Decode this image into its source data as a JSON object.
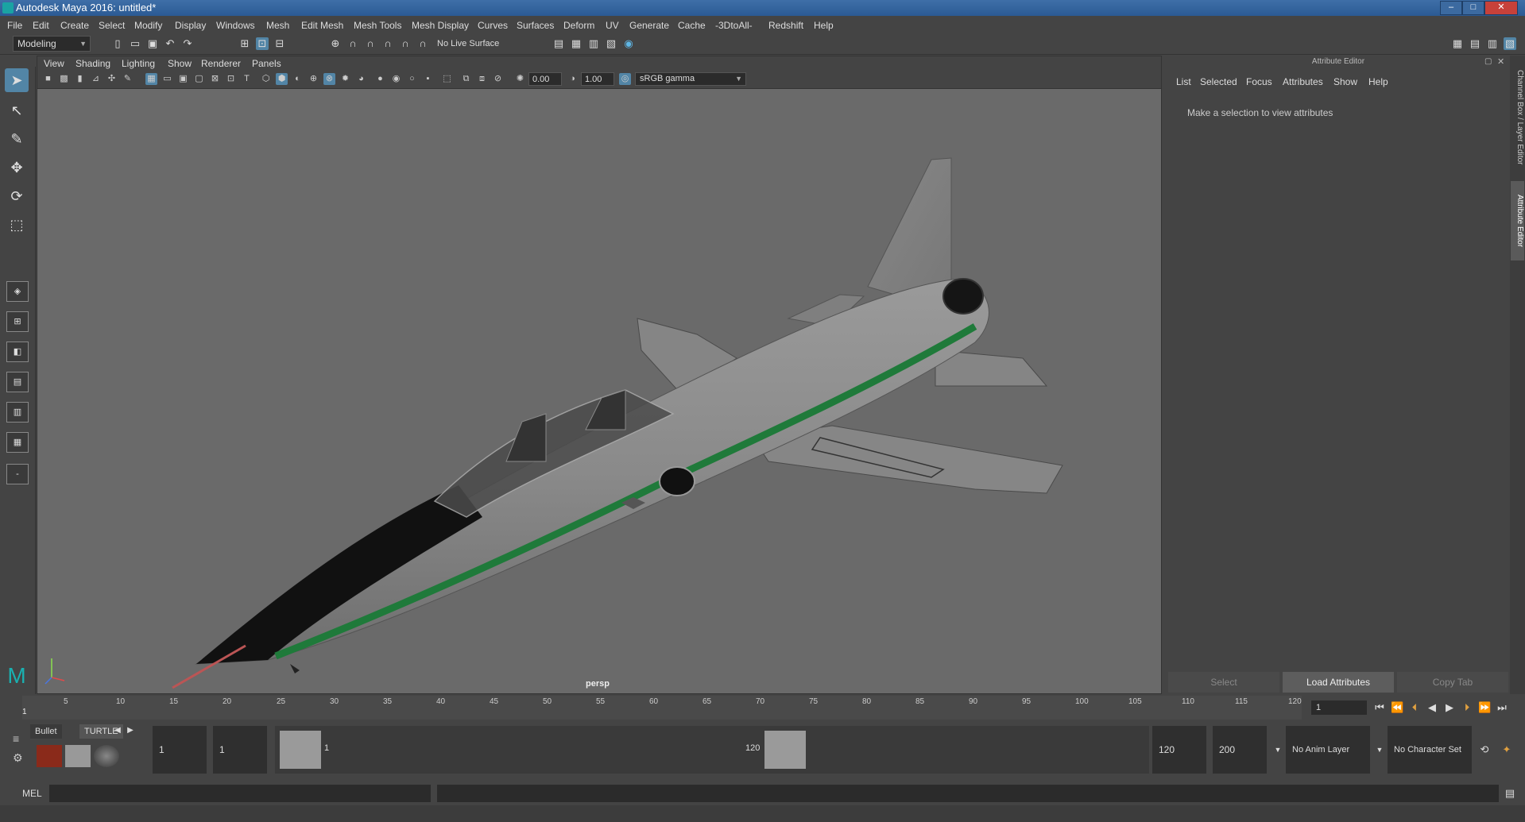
{
  "window": {
    "title": "Autodesk Maya 2016: untitled*"
  },
  "menubar": [
    "File",
    "Edit",
    "Create",
    "Select",
    "Modify",
    "Display",
    "Windows",
    "Mesh",
    "Edit Mesh",
    "Mesh Tools",
    "Mesh Display",
    "Curves",
    "Surfaces",
    "Deform",
    "UV",
    "Generate",
    "Cache",
    "-3DtoAll-",
    "Redshift",
    "Help"
  ],
  "status": {
    "menuset": "Modeling",
    "live_surface": "No Live Surface"
  },
  "viewport": {
    "menu": [
      "View",
      "Shading",
      "Lighting",
      "Show",
      "Renderer",
      "Panels"
    ],
    "exposure": "0.00",
    "gamma": "1.00",
    "color_space": "sRGB gamma",
    "camera": "persp"
  },
  "attribute_editor": {
    "title": "Attribute Editor",
    "menu": [
      "List",
      "Selected",
      "Focus",
      "Attributes",
      "Show",
      "Help"
    ],
    "message": "Make a selection to view attributes",
    "buttons": {
      "select": "Select",
      "load": "Load Attributes",
      "copy": "Copy Tab"
    }
  },
  "side_tabs": {
    "channel_box": "Channel Box / Layer Editor",
    "attr_editor": "Attribute Editor"
  },
  "timeline": {
    "ticks": [
      "5",
      "10",
      "15",
      "20",
      "25",
      "30",
      "35",
      "40",
      "45",
      "50",
      "55",
      "60",
      "65",
      "70",
      "75",
      "80",
      "85",
      "90",
      "95",
      "100",
      "105",
      "110",
      "115",
      "120"
    ],
    "first": "1",
    "current_frame": "1"
  },
  "range": {
    "start": "1",
    "playback_start": "1",
    "slider_min": "1",
    "slider_max": "120",
    "playback_end": "120",
    "end": "200",
    "anim_layer": "No Anim Layer",
    "character_set": "No Character Set"
  },
  "shelf": {
    "tab1": "Bullet",
    "tab2": "TURTLE"
  },
  "cmdline": {
    "label": "MEL"
  },
  "colors": {
    "accent": "#5285a6",
    "stripe": "#1f7a3a",
    "viewport_bg": "#6a6a6a"
  }
}
